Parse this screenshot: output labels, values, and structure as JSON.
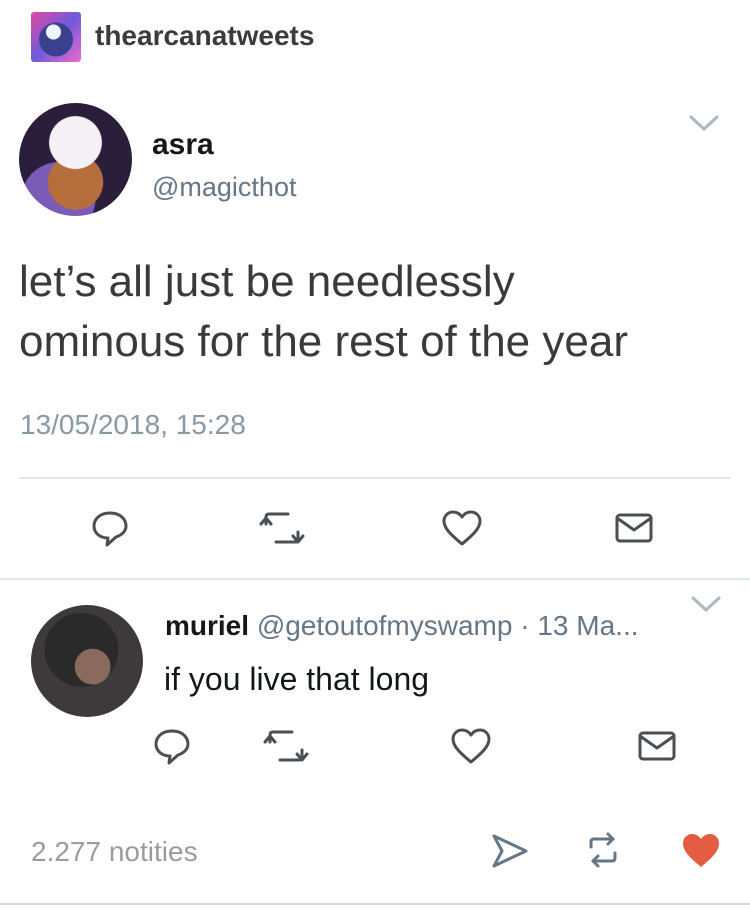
{
  "blog": {
    "name": "thearcanatweets"
  },
  "tweet": {
    "display_name": "asra",
    "handle": "@magicthot",
    "text_line1": "let’s all just be needlessly",
    "text_line2": "ominous for the rest of the year",
    "timestamp": "13/05/2018, 15:28"
  },
  "reply": {
    "display_name": "muriel",
    "handle": "@getoutofmyswamp",
    "separator": "·",
    "date": "13 Ma...",
    "text": "if you live that long"
  },
  "footer": {
    "notes": "2.277 notities"
  },
  "colors": {
    "heart": "#e45d42",
    "handle_gray": "#657786"
  }
}
